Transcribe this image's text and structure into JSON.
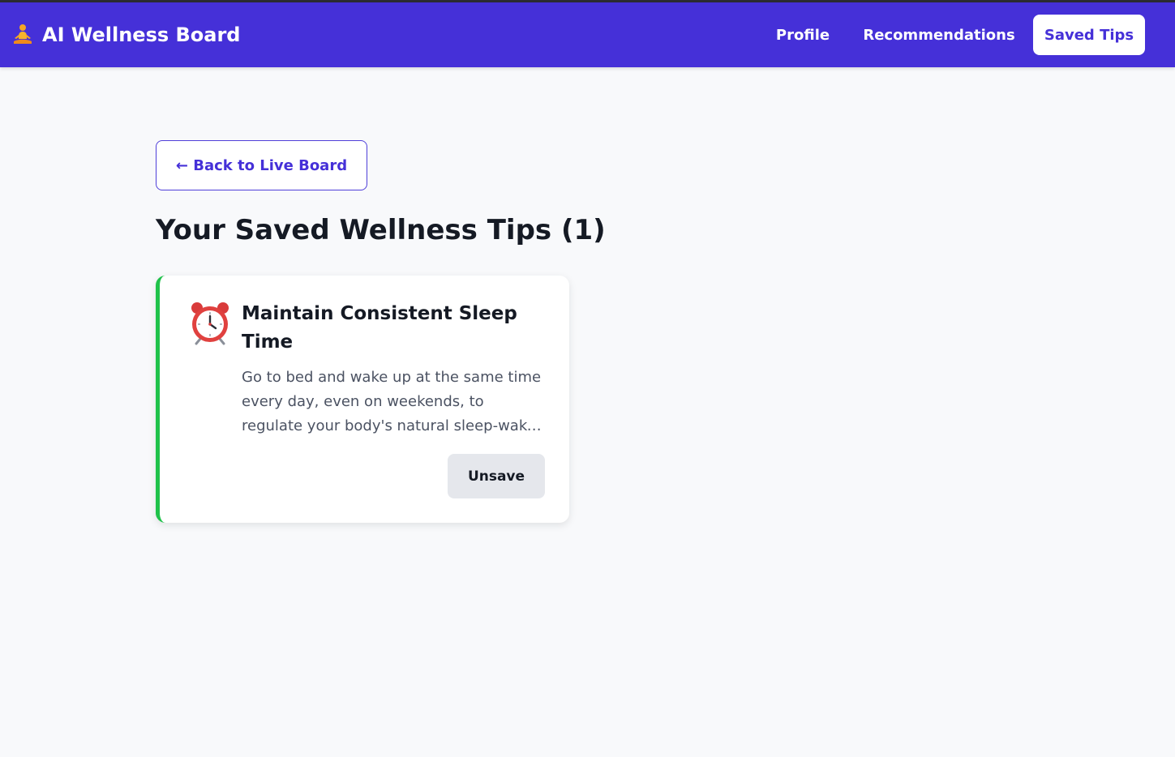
{
  "header": {
    "brand_icon": "meditating-person-icon",
    "brand_title": "AI Wellness Board",
    "nav": {
      "profile": "Profile",
      "recommendations": "Recommendations",
      "saved_tips": "Saved Tips"
    },
    "active_nav": "saved_tips",
    "accent_color": "#4530d8"
  },
  "main": {
    "back_button": "← Back to Live Board",
    "page_title": "Your Saved Wellness Tips (1)",
    "tips": [
      {
        "icon": "alarm-clock-icon",
        "title": "Maintain Consistent Sleep Time",
        "description": "Go to bed and wake up at the same time every day, even on weekends, to regulate your body's natural sleep-wake cycle.",
        "unsave_label": "Unsave",
        "accent_color": "#1fc24a"
      }
    ]
  }
}
